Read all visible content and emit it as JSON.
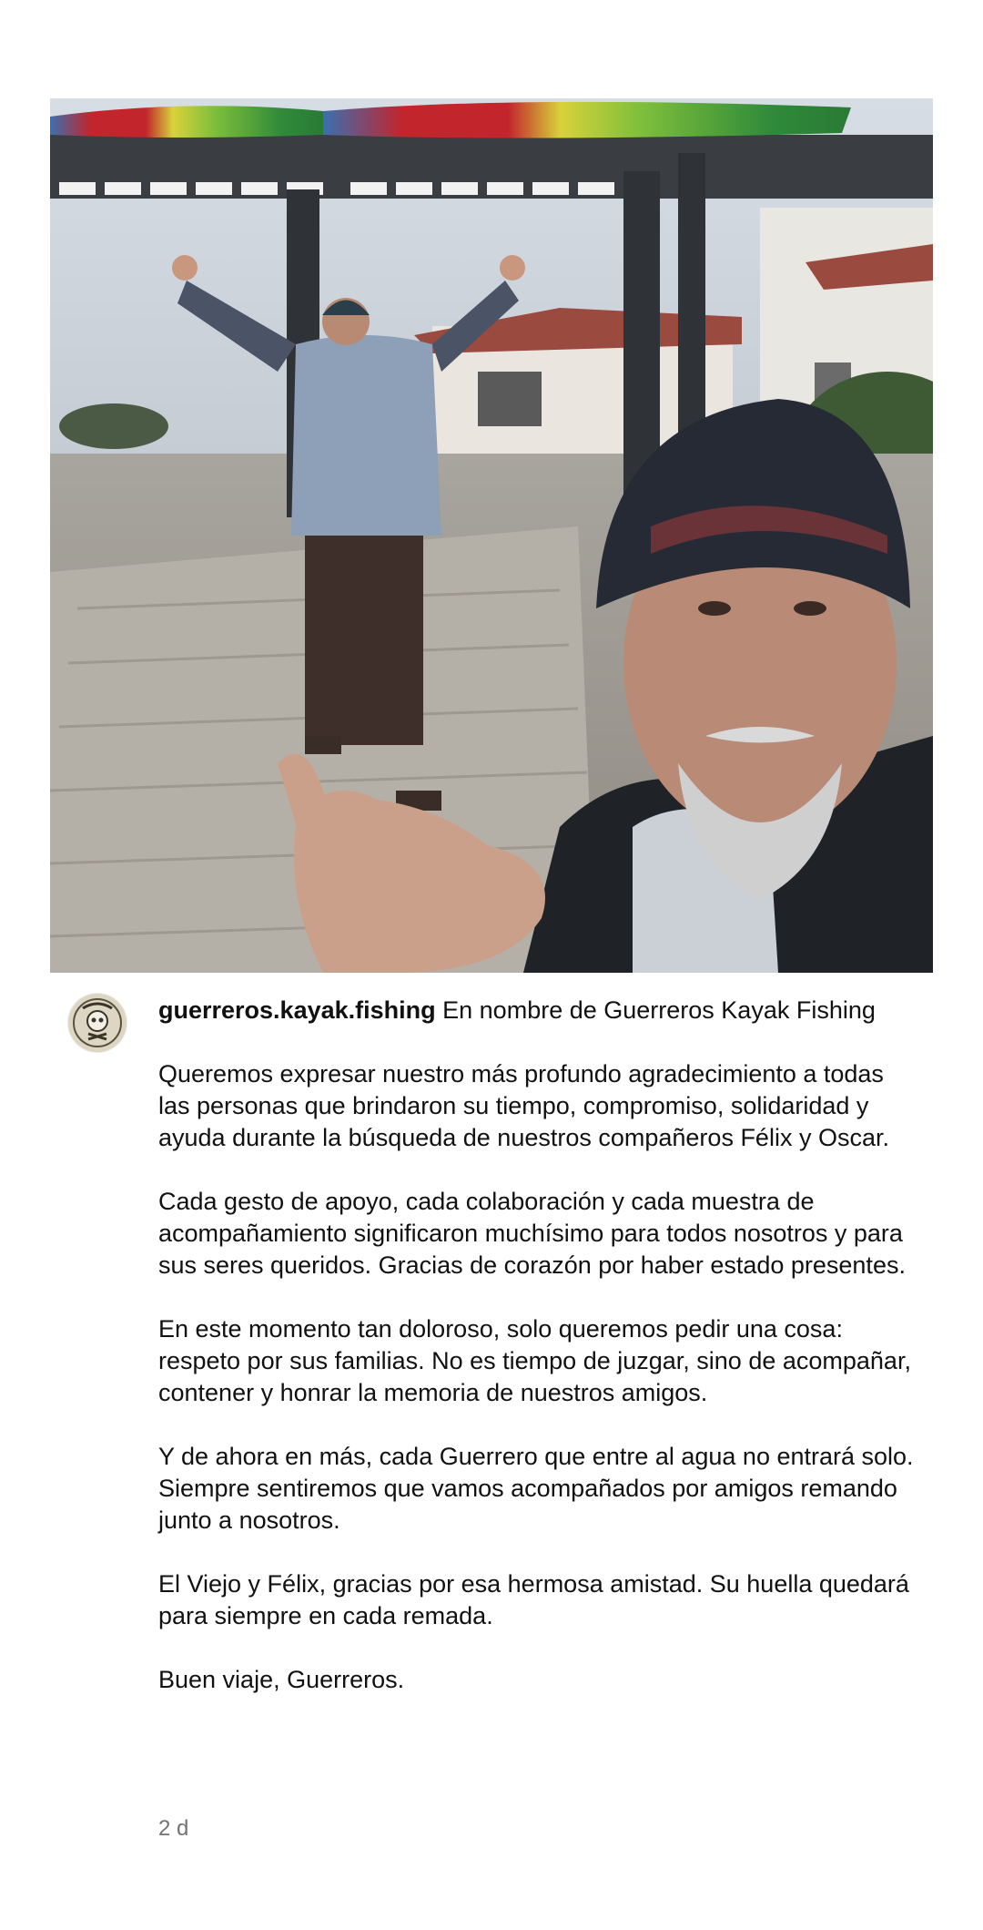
{
  "post": {
    "image_alt": "",
    "username": "guerreros.kayak.fishing",
    "caption_first_line": "En nombre de Guerreros Kayak Fishing",
    "paragraphs": [
      "Queremos expresar nuestro más profundo agradecimiento a todas las personas que brindaron su tiempo, compromiso, solidaridad y ayuda durante la búsqueda de nuestros compañeros Félix y Oscar.",
      "Cada gesto de apoyo, cada colaboración y cada muestra de acompañamiento significaron muchísimo para todos nosotros y para sus seres queridos. Gracias de corazón por haber estado presentes.",
      "En este momento tan doloroso, solo queremos pedir una cosa: respeto por sus familias. No es tiempo de juzgar, sino de acompañar, contener y honrar la memoria de nuestros amigos.",
      "Y de ahora en más, cada Guerrero que entre al agua no entrará solo. Siempre sentiremos que vamos acompañados por amigos remando junto a nosotros.",
      "El Viejo y Félix, gracias por esa hermosa amistad. Su huella quedará para siempre en cada remada.",
      "Buen viaje, Guerreros."
    ],
    "timestamp": "2 d"
  },
  "icons": {
    "avatar": "avatar-logo-icon"
  }
}
